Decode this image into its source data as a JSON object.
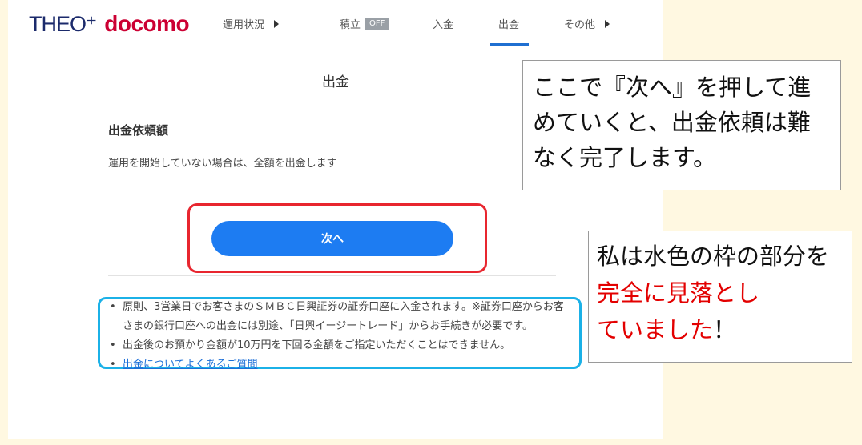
{
  "header": {
    "logo_theo": "THEO⁺",
    "logo_docomo": "docomo",
    "nav": [
      {
        "label": "運用状況",
        "has_arrow": true
      },
      {
        "label": "積立",
        "badge": "OFF"
      },
      {
        "label": "入金"
      },
      {
        "label": "出金",
        "active": true
      },
      {
        "label": "その他",
        "has_arrow": true
      }
    ]
  },
  "page": {
    "title": "出金",
    "section_heading": "出金依頼額",
    "section_desc": "運用を開始していない場合は、全額を出金します",
    "next_button": "次へ"
  },
  "notes": [
    {
      "text": "原則、3営業日でお客さまのＳＭＢＣ日興証券の証券口座に入金されます。※証券口座からお客さまの銀行口座への出金には別途、「日興イージートレード」からお手続きが必要です。"
    },
    {
      "text": "出金後のお預かり金額が10万円を下回る金額をご指定いただくことはできません。"
    },
    {
      "link": "出金についてよくあるご質問"
    }
  ],
  "callouts": {
    "first": "ここで『次へ』を押して進めていくと、出金依頼は難なく完了します。",
    "second_pre": "私は水色の枠の部分を",
    "second_red": "完全に見落とし",
    "second_post": "ていました",
    "second_mark": "！"
  },
  "colors": {
    "accent": "#1d7cf2",
    "highlight_red": "#e8262f",
    "highlight_blue": "#1bb1e7",
    "background": "#fff8e1",
    "emphasis_text": "#e30000"
  }
}
